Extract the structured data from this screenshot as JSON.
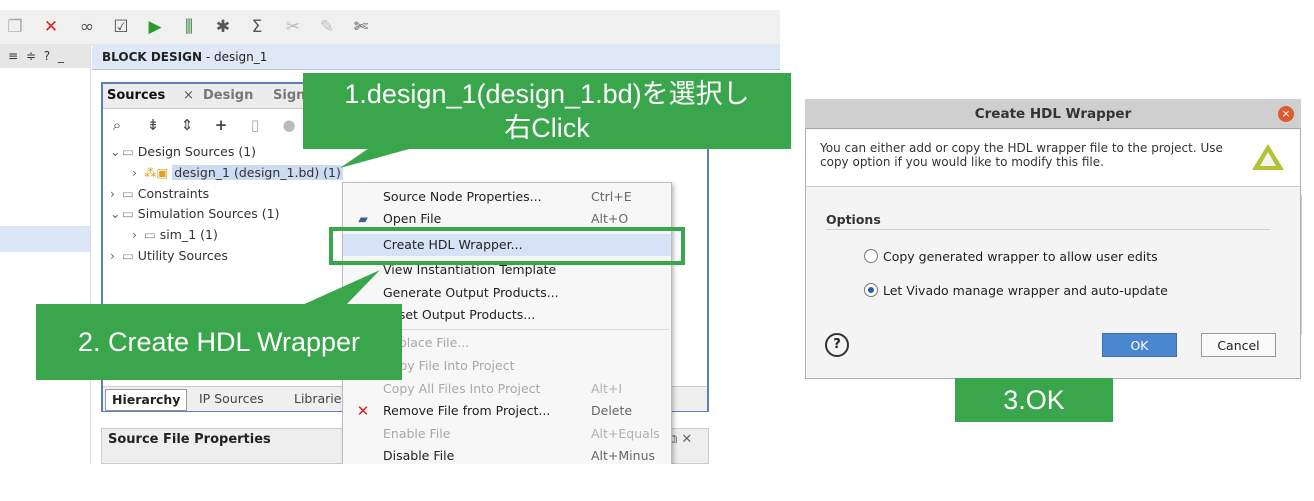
{
  "block_design": {
    "title": "BLOCK DESIGN",
    "name": " - design_1"
  },
  "colors": {
    "annotation_green": "#3aa64c",
    "ok_blue": "#4a87d0",
    "selection_blue": "#d6e2f5"
  },
  "left_strip": {
    "icons": "≡ ≑ ? _"
  },
  "sources": {
    "tabs": [
      "Sources",
      "Design",
      "Sign"
    ],
    "tab_close": "×",
    "tree": {
      "design_sources": "Design Sources (1)",
      "design_1": "design_1 (design_1.bd) (1)",
      "constraints": "Constraints",
      "simulation_sources": "Simulation Sources (1)",
      "sim_1": "sim_1 (1)",
      "utility_sources": "Utility Sources"
    },
    "bottom_tabs": [
      "Hierarchy",
      "IP Sources",
      "Librarie"
    ]
  },
  "source_file_properties": {
    "title": "Source File Properties",
    "icons": "⧉ ✕"
  },
  "context_menu": {
    "items": [
      {
        "label": "Source Node Properties...",
        "shortcut": "Ctrl+E"
      },
      {
        "label": "Open File",
        "shortcut": "Alt+O"
      },
      {
        "label": "Create HDL Wrapper...",
        "shortcut": ""
      },
      {
        "label": "View Instantiation Template",
        "shortcut": ""
      },
      {
        "label": "Generate Output Products...",
        "shortcut": ""
      },
      {
        "label": "Reset Output Products...",
        "shortcut": ""
      },
      {
        "label": "Replace File...",
        "shortcut": ""
      },
      {
        "label": "Copy File Into Project",
        "shortcut": ""
      },
      {
        "label": "Copy All Files Into Project",
        "shortcut": "Alt+I"
      },
      {
        "label": "Remove File from Project...",
        "shortcut": "Delete"
      },
      {
        "label": "Enable File",
        "shortcut": "Alt+Equals"
      },
      {
        "label": "Disable File",
        "shortcut": "Alt+Minus"
      }
    ]
  },
  "annotations": {
    "step1_line1": "1.design_1(design_1.bd)を選択し",
    "step1_line2": "右Click",
    "step2": "2. Create HDL Wrapper",
    "step3": "3.OK"
  },
  "dialog": {
    "title": "Create HDL Wrapper",
    "message_line1": "You can either add or copy the HDL wrapper file to the project. Use",
    "message_line2": "copy option if you would like to modify this file.",
    "options_label": "Options",
    "option_copy": "Copy generated wrapper to allow user edits",
    "option_manage": "Let Vivado manage wrapper and auto-update",
    "selected_option": "option_manage",
    "help": "?",
    "ok": "OK",
    "cancel": "Cancel",
    "close": "×"
  }
}
